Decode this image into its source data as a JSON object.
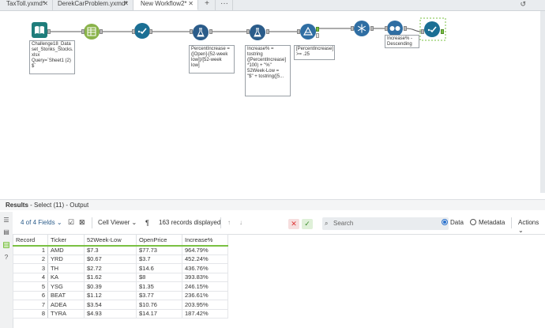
{
  "tabs": [
    {
      "label": "TaxToll.yxmd*",
      "active": false
    },
    {
      "label": "DerekCarProblem.yxmd*",
      "active": false
    },
    {
      "label": "New Workflow2*",
      "active": true
    }
  ],
  "tab_add": "+",
  "tab_more": "···",
  "workflow": {
    "annotations": {
      "input": "Challenge18_Data\nset_Stonks_Stocks.\nxlsx\nQuery=`Sheet1 (2)\n$`",
      "formula1": "PercentIncrease =\n([Open]-[52-week\nlow])/[52-week\nlow]",
      "formula2": "Increase% =\ntostring\n([PercentIncrease]\n*100) + \"%\"\n52Week-Low =\n\"$\" + tostring([5...",
      "filter": "[PercentIncrease]\n>= .25",
      "sort": "Increase% -\nDescending"
    }
  },
  "results": {
    "title_bold": "Results",
    "title_rest": " - Select (11) - Output",
    "fields_label": "4 of 4 Fields",
    "cell_viewer": "Cell Viewer",
    "records_displayed": "163 records displayed",
    "search_placeholder": "Search",
    "data_label": "Data",
    "metadata_label": "Metadata",
    "actions_label": "Actions",
    "columns": [
      "Record",
      "Ticker",
      "52Week-Low",
      "OpenPrice",
      "Increase%"
    ],
    "rows": [
      [
        "1",
        "AMD",
        "$7.3",
        "$77.73",
        "964.79%"
      ],
      [
        "2",
        "YRD",
        "$0.67",
        "$3.7",
        "452.24%"
      ],
      [
        "3",
        "TH",
        "$2.72",
        "$14.6",
        "436.76%"
      ],
      [
        "4",
        "KA",
        "$1.62",
        "$8",
        "393.83%"
      ],
      [
        "5",
        "YSG",
        "$0.39",
        "$1.35",
        "246.15%"
      ],
      [
        "6",
        "BEAT",
        "$1.12",
        "$3.77",
        "236.61%"
      ],
      [
        "7",
        "ADEA",
        "$3.54",
        "$10.76",
        "203.95%"
      ],
      [
        "8",
        "TYRA",
        "$4.93",
        "$14.17",
        "187.42%"
      ]
    ]
  },
  "colors": {
    "input": "#1f7d7b",
    "select": "#8ab34a",
    "browse": "#1b6f94",
    "formula": "#2b5c8a",
    "filter": "#2f6ea3",
    "sort": "#2f6ea3",
    "accent": "#7ac142"
  }
}
